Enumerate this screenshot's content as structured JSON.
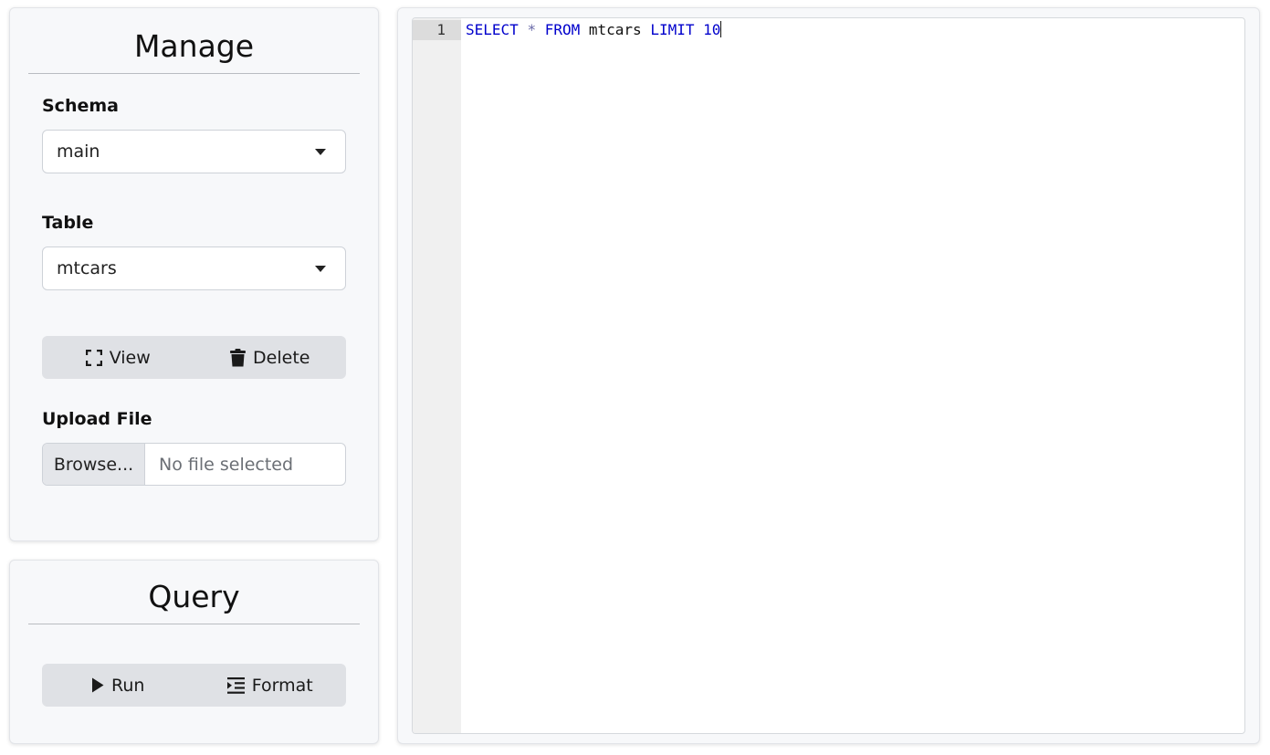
{
  "manage": {
    "title": "Manage",
    "schema": {
      "label": "Schema",
      "selected": "main"
    },
    "table": {
      "label": "Table",
      "selected": "mtcars"
    },
    "actions": {
      "view_label": "View",
      "delete_label": "Delete"
    },
    "upload": {
      "label": "Upload File",
      "browse_label": "Browse...",
      "placeholder": "No file selected"
    }
  },
  "query": {
    "title": "Query",
    "actions": {
      "run_label": "Run",
      "format_label": "Format"
    }
  },
  "editor": {
    "line_number": "1",
    "tokens": {
      "select": "SELECT",
      "star": "*",
      "from": "FROM",
      "table": "mtcars",
      "limit": "LIMIT",
      "count": "10"
    }
  },
  "icons": {
    "view": "expand-icon",
    "delete": "trash-icon",
    "run": "play-icon",
    "format": "indent-icon",
    "dropdown": "caret-down-icon"
  }
}
